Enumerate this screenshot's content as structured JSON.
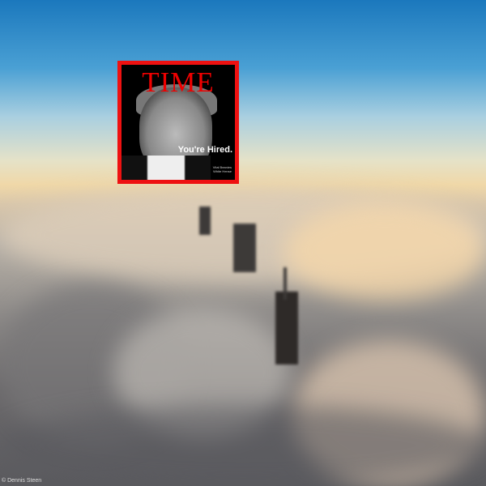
{
  "cover": {
    "masthead": "TIME",
    "headline": "You're Hired.",
    "subline": "Vital Beanies White Hense"
  },
  "photo_credit": "© Dennis Steen",
  "colors": {
    "cover_border": "#ee1111",
    "masthead": "#ee0000",
    "sky_top": "#1b78bd",
    "horizon": "#f0d8a8"
  }
}
